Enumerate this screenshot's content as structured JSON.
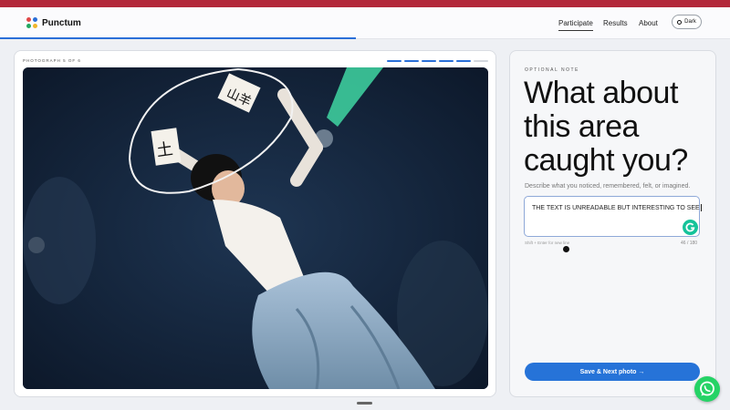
{
  "header": {
    "app_name": "Punctum",
    "nav": [
      {
        "label": "Participate",
        "active": true
      },
      {
        "label": "Results",
        "active": false
      },
      {
        "label": "About",
        "active": false
      }
    ],
    "theme_toggle": "Dark"
  },
  "photo_panel": {
    "label": "PHOTOGRAPH 5 OF 6",
    "progress": {
      "current": 5,
      "total": 6
    },
    "photo_text": {
      "sign_left": "土",
      "sign_right": "山羊"
    }
  },
  "note_panel": {
    "label": "OPTIONAL NOTE",
    "title": "What about this area caught you?",
    "description": "Describe what you noticed, remembered, felt, or imagined.",
    "input_value": "THE TEXT IS UNREADABLE BUT INTERESTING TO SEE",
    "hint": "Shift + Enter for new line",
    "char_count": "46 / 180",
    "save_button": "Save & Next photo →"
  },
  "icons": {
    "logo": "punctum-logo-icon",
    "theme": "ring-icon",
    "grammarly": "grammarly-icon",
    "whatsapp": "whatsapp-icon"
  },
  "colors": {
    "top_stripe": "#b3283a",
    "accent": "#2a6fd8",
    "primary_button": "#2673d8",
    "grammarly": "#15c39a",
    "whatsapp": "#25d366",
    "progress_done": "#2a6fd8",
    "progress_todo": "#d3d7de"
  }
}
